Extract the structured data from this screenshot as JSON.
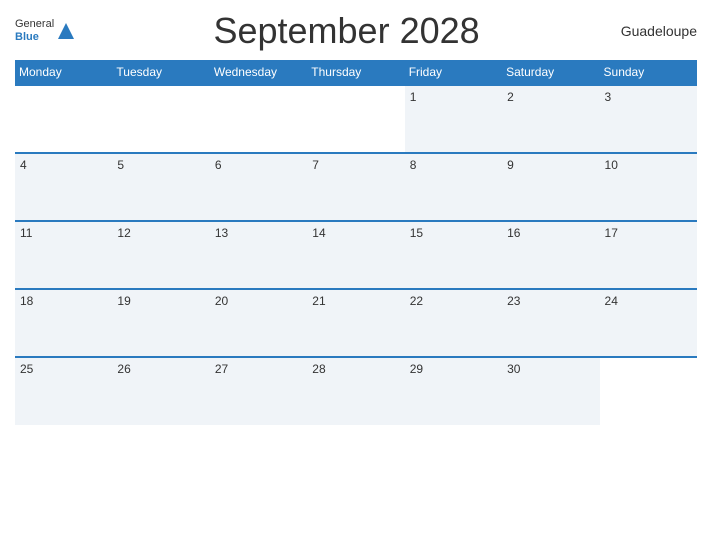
{
  "header": {
    "title": "September 2028",
    "country": "Guadeloupe",
    "logo": {
      "line1": "General",
      "line2": "Blue"
    }
  },
  "days_of_week": [
    "Monday",
    "Tuesday",
    "Wednesday",
    "Thursday",
    "Friday",
    "Saturday",
    "Sunday"
  ],
  "weeks": [
    [
      {
        "day": "",
        "empty": true
      },
      {
        "day": "",
        "empty": true
      },
      {
        "day": "",
        "empty": true
      },
      {
        "day": "",
        "empty": true
      },
      {
        "day": "1"
      },
      {
        "day": "2"
      },
      {
        "day": "3"
      }
    ],
    [
      {
        "day": "4"
      },
      {
        "day": "5"
      },
      {
        "day": "6"
      },
      {
        "day": "7"
      },
      {
        "day": "8"
      },
      {
        "day": "9"
      },
      {
        "day": "10"
      }
    ],
    [
      {
        "day": "11"
      },
      {
        "day": "12"
      },
      {
        "day": "13"
      },
      {
        "day": "14"
      },
      {
        "day": "15"
      },
      {
        "day": "16"
      },
      {
        "day": "17"
      }
    ],
    [
      {
        "day": "18"
      },
      {
        "day": "19"
      },
      {
        "day": "20"
      },
      {
        "day": "21"
      },
      {
        "day": "22"
      },
      {
        "day": "23"
      },
      {
        "day": "24"
      }
    ],
    [
      {
        "day": "25"
      },
      {
        "day": "26"
      },
      {
        "day": "27"
      },
      {
        "day": "28"
      },
      {
        "day": "29"
      },
      {
        "day": "30"
      },
      {
        "day": "",
        "empty": true
      }
    ]
  ]
}
